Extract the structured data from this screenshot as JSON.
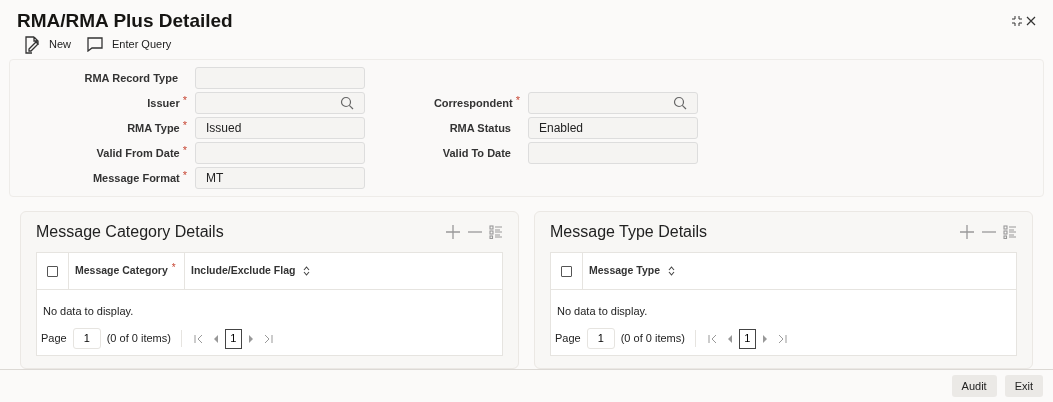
{
  "title": "RMA/RMA Plus Detailed",
  "toolbar": [
    {
      "label": "New",
      "kind": "new"
    },
    {
      "label": "Enter Query",
      "kind": "query"
    }
  ],
  "form": {
    "left": [
      {
        "label": "RMA Record Type",
        "kind": "text"
      },
      {
        "label": "Issuer",
        "marker": "*",
        "kind": "lookup"
      },
      {
        "label": "RMA Type",
        "marker": "*",
        "value": "Issued",
        "kind": "text"
      },
      {
        "label": "Valid From Date",
        "marker": "*",
        "kind": "text"
      },
      {
        "label": "Message Format",
        "marker": "*",
        "value": "MT",
        "kind": "text"
      }
    ],
    "right": [
      {
        "label": "Correspondent",
        "marker": "*",
        "kind": "lookup"
      },
      {
        "label": "RMA Status",
        "value": "Enabled",
        "kind": "text"
      },
      {
        "label": "Valid To Date",
        "kind": "text"
      }
    ]
  },
  "sections": [
    {
      "title": "Message Category Details",
      "select_all_checked": false,
      "columns": [
        {
          "label": "Message Category",
          "marker": "*"
        },
        {
          "label": "Include/Exclude Flag",
          "sortable": true
        }
      ],
      "empty_message": "No data to display.",
      "page_label": "Page",
      "page_value": "1",
      "items_text": "(0 of 0 items)",
      "current_page": "1"
    },
    {
      "title": "Message Type Details",
      "select_all_checked": false,
      "columns": [
        {
          "label": "Message Type",
          "sortable": true
        }
      ],
      "empty_message": "No data to display.",
      "page_label": "Page",
      "page_value": "1",
      "items_text": "(0 of 0 items)",
      "current_page": "1"
    }
  ],
  "footer_buttons": [
    "Audit",
    "Exit"
  ]
}
